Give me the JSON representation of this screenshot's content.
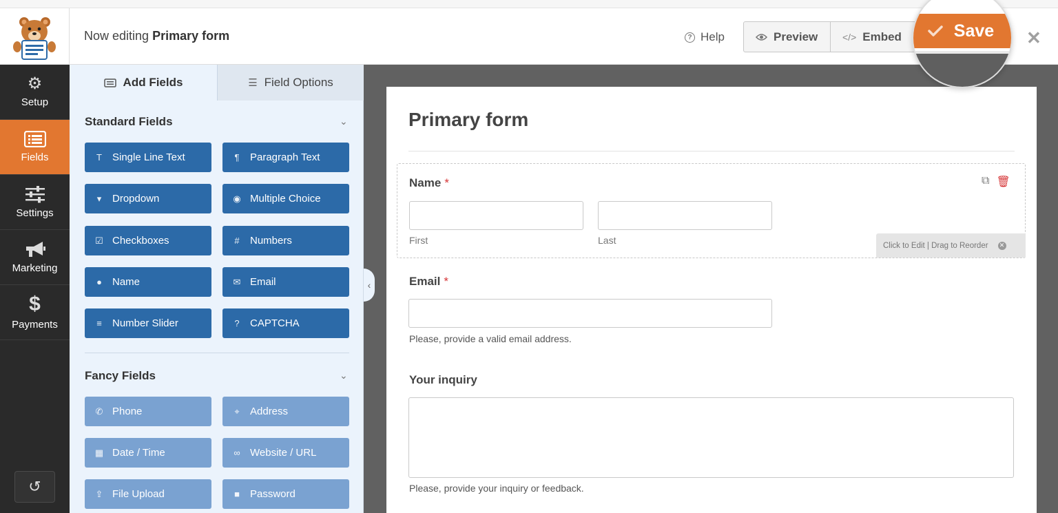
{
  "header": {
    "title_prefix": "Now editing",
    "form_name": "Primary form",
    "help_label": "Help",
    "preview_label": "Preview",
    "embed_label": "Embed",
    "save_label": "Save",
    "accent_color": "#e27730"
  },
  "leftnav": {
    "items": [
      {
        "label": "Setup",
        "icon": "gear-icon"
      },
      {
        "label": "Fields",
        "icon": "fields-list-icon",
        "active": true
      },
      {
        "label": "Settings",
        "icon": "sliders-icon"
      },
      {
        "label": "Marketing",
        "icon": "megaphone-icon"
      },
      {
        "label": "Payments",
        "icon": "dollar-icon"
      }
    ]
  },
  "panel": {
    "tabs": [
      {
        "label": "Add Fields",
        "icon": "list-icon"
      },
      {
        "label": "Field Options",
        "icon": "sliders-icon"
      }
    ],
    "standard_title": "Standard Fields",
    "standard_fields": [
      {
        "label": "Single Line Text",
        "icon": "text-icon"
      },
      {
        "label": "Paragraph Text",
        "icon": "paragraph-icon"
      },
      {
        "label": "Dropdown",
        "icon": "dropdown-icon"
      },
      {
        "label": "Multiple Choice",
        "icon": "radio-icon"
      },
      {
        "label": "Checkboxes",
        "icon": "checkbox-icon"
      },
      {
        "label": "Numbers",
        "icon": "hash-icon"
      },
      {
        "label": "Name",
        "icon": "user-icon"
      },
      {
        "label": "Email",
        "icon": "envelope-icon"
      },
      {
        "label": "Number Slider",
        "icon": "sliders-icon"
      },
      {
        "label": "CAPTCHA",
        "icon": "question-circle-icon"
      }
    ],
    "fancy_title": "Fancy Fields",
    "fancy_fields": [
      {
        "label": "Phone",
        "icon": "phone-icon"
      },
      {
        "label": "Address",
        "icon": "map-pin-icon"
      },
      {
        "label": "Date / Time",
        "icon": "calendar-icon"
      },
      {
        "label": "Website / URL",
        "icon": "link-icon"
      },
      {
        "label": "File Upload",
        "icon": "upload-icon"
      },
      {
        "label": "Password",
        "icon": "lock-icon"
      }
    ]
  },
  "form": {
    "title": "Primary form",
    "name_label": "Name",
    "required_mark": "*",
    "first_label": "First",
    "last_label": "Last",
    "edit_hint": "Click to Edit | Drag to Reorder",
    "email_label": "Email",
    "email_desc": "Please, provide a valid email address.",
    "inquiry_label": "Your inquiry",
    "inquiry_desc": "Please, provide your inquiry or feedback."
  }
}
